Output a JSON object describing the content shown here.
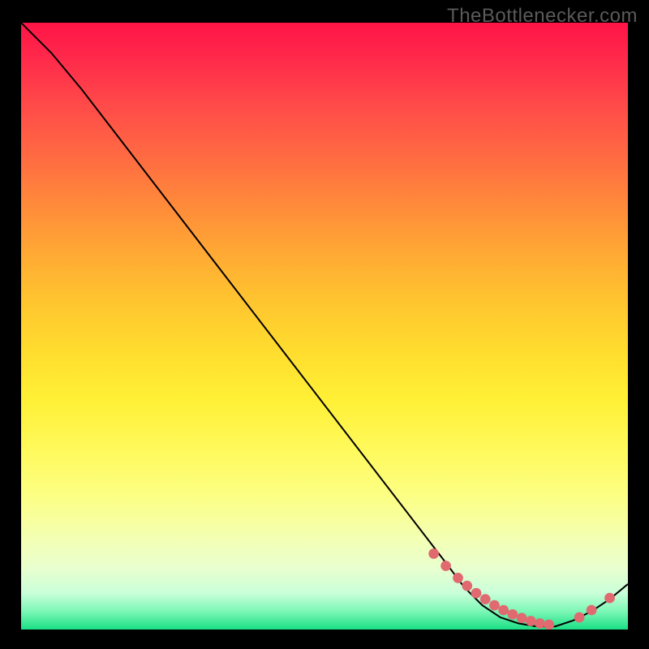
{
  "attribution": "TheBottlenecker.com",
  "chart_data": {
    "type": "line",
    "title": "",
    "xlabel": "",
    "ylabel": "",
    "xlim": [
      0,
      100
    ],
    "ylim": [
      0,
      100
    ],
    "series": [
      {
        "name": "curve",
        "x": [
          0,
          5,
          10,
          15,
          20,
          25,
          30,
          35,
          40,
          45,
          50,
          55,
          60,
          65,
          70,
          73,
          76,
          79,
          82,
          85,
          88,
          91,
          94,
          97,
          100
        ],
        "y": [
          100,
          95,
          89,
          82.5,
          76,
          69.5,
          63,
          56.5,
          50,
          43.5,
          37,
          30.5,
          24,
          17.5,
          11,
          7,
          4,
          2,
          1,
          0.5,
          0.5,
          1.5,
          3,
          5,
          7.5
        ]
      }
    ],
    "markers": {
      "name": "highlight-dots",
      "x": [
        68,
        70,
        72,
        73.5,
        75,
        76.5,
        78,
        79.5,
        81,
        82.5,
        84,
        85.5,
        87,
        92,
        94,
        97
      ],
      "y": [
        12.5,
        10.5,
        8.5,
        7.2,
        6,
        5,
        4,
        3.2,
        2.5,
        1.9,
        1.4,
        1.0,
        0.8,
        2.0,
        3.2,
        5.2
      ]
    },
    "marker_color": "#e06a70",
    "curve_color": "#000000"
  }
}
